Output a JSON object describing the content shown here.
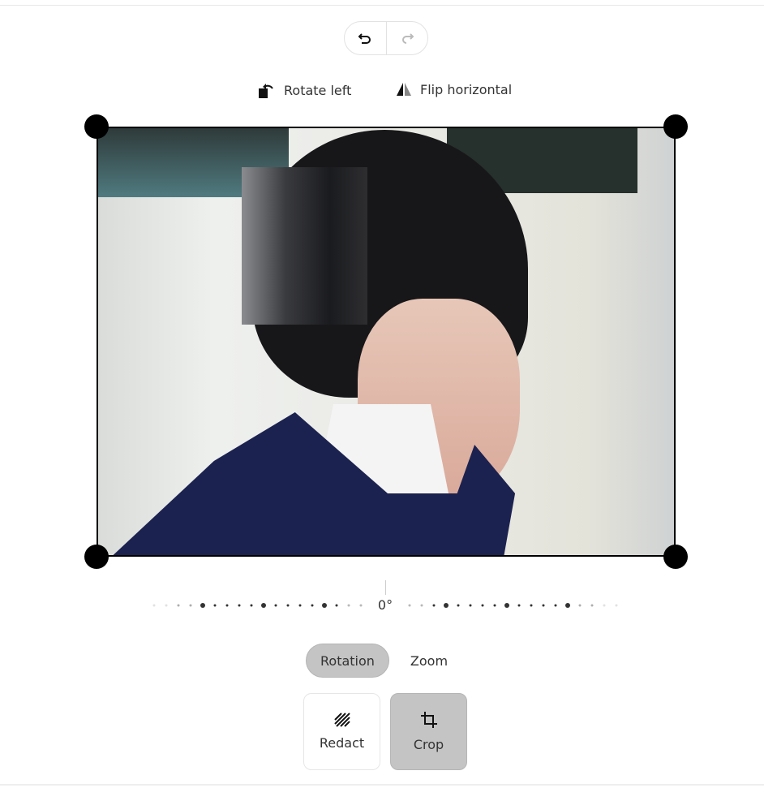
{
  "history": {
    "undo_icon": "undo-icon",
    "redo_icon": "redo-icon",
    "redo_enabled": false
  },
  "tools": {
    "rotate_left": "Rotate left",
    "flip_horizontal": "Flip horizontal"
  },
  "rotation": {
    "value_label": "0°",
    "value": 0
  },
  "modes": [
    {
      "label": "Rotation",
      "active": true
    },
    {
      "label": "Zoom",
      "active": false
    }
  ],
  "actions": [
    {
      "label": "Redact",
      "icon": "redact-icon",
      "active": false
    },
    {
      "label": "Crop",
      "icon": "crop-icon",
      "active": true
    }
  ]
}
